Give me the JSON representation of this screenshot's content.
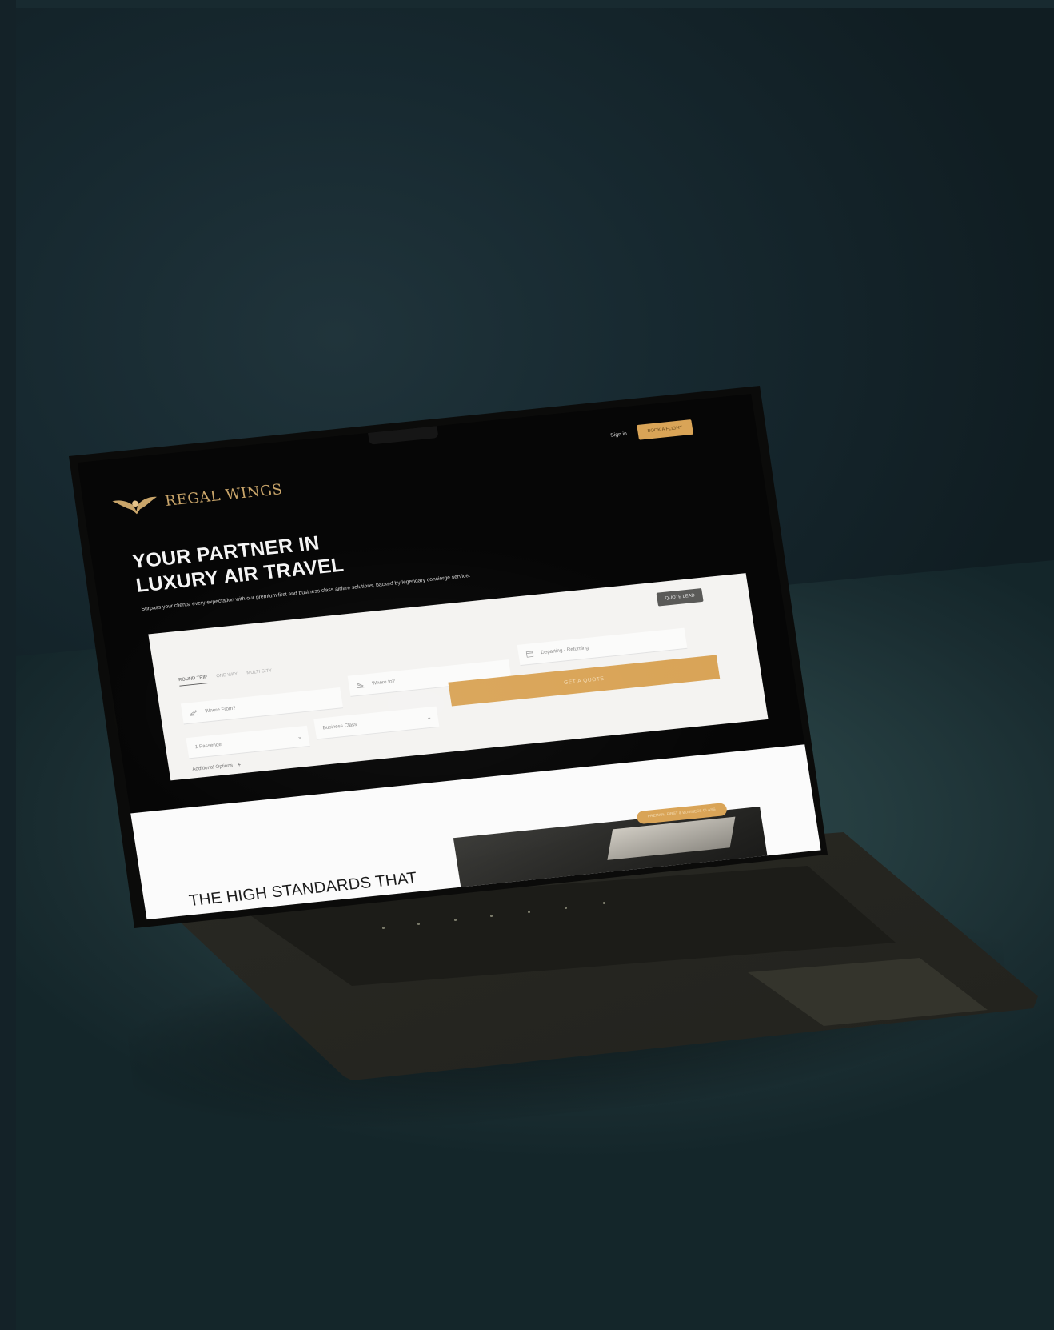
{
  "brand": {
    "name": "REGAL WINGS",
    "accent_color": "#d9a457",
    "logo_icon": "winged-crest-icon"
  },
  "nav": {
    "signin_label": "Sign in",
    "cta_label": "BOOK A FLIGHT"
  },
  "hero": {
    "title_line1": "YOUR PARTNER IN",
    "title_line2": "LUXURY AIR TRAVEL",
    "subtitle": "Surpass your clients' every expectation with our premium first and business class airfare solutions, backed by legendary concierge service."
  },
  "booking": {
    "secondary_button": "QUOTE LEAD",
    "tabs": [
      {
        "label": "ROUND TRIP",
        "active": true
      },
      {
        "label": "ONE WAY",
        "active": false
      },
      {
        "label": "MULTI CITY",
        "active": false
      }
    ],
    "from_placeholder": "Where From?",
    "to_placeholder": "Where to?",
    "dates_placeholder": "Departing - Returning",
    "passengers_value": "1 Passenger",
    "class_value": "Business Class",
    "submit_label": "GET A QUOTE",
    "additional_label": "Additional Options"
  },
  "section": {
    "title": "THE HIGH STANDARDS THAT",
    "badge_text": "PREMIUM FIRST & BUSINESS CLASS"
  }
}
